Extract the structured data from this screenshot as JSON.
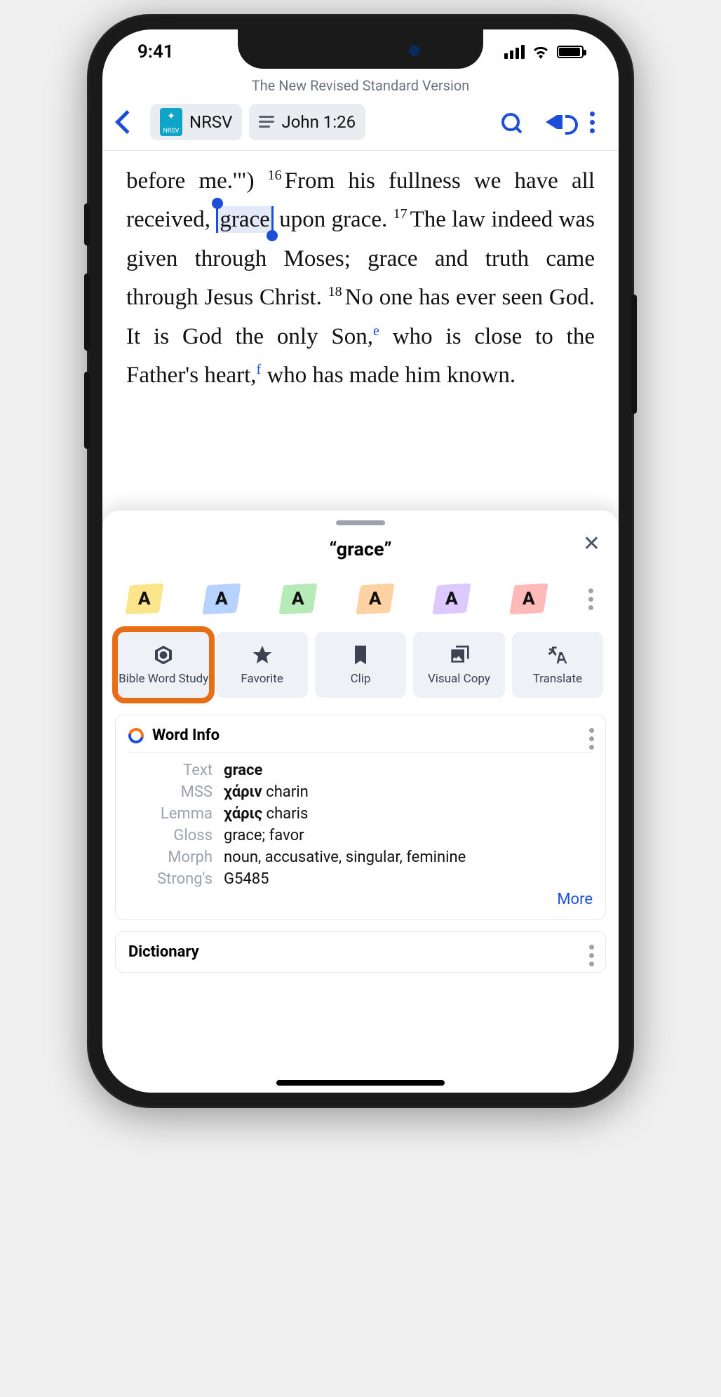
{
  "status": {
    "time": "9:41"
  },
  "header": {
    "version_title": "The New Revised Standard Version",
    "version_abbr": "NRSV",
    "reference": "John 1:26"
  },
  "scripture": {
    "pre_16": "before me.'\")",
    "v16_num": "16",
    "v16_a": "From his fullness we have all received, ",
    "v16_sel": "grace",
    "v16_b": " upon grace.",
    "v17_num": "17",
    "v17": "The law indeed was given through Moses; grace and truth came through Jesus Christ.",
    "v18_num": "18",
    "v18_a": "No one has ever seen God. It is God the only Son,",
    "fn_e": "e",
    "v18_b": " who is close to the Father's heart,",
    "fn_f": "f",
    "v18_c": " who has made him known."
  },
  "sheet": {
    "title": "“grace”",
    "highlight_letter": "A",
    "actions": {
      "word_study": "Bible Word Study",
      "favorite": "Favorite",
      "clip": "Clip",
      "visual_copy": "Visual Copy",
      "translate": "Translate"
    },
    "word_info": {
      "heading": "Word Info",
      "labels": {
        "text": "Text",
        "mss": "MSS",
        "lemma": "Lemma",
        "gloss": "Gloss",
        "morph": "Morph",
        "strongs": "Strong's"
      },
      "text": "grace",
      "mss_greek": "χάριν",
      "mss_translit": "charin",
      "lemma_greek": "χάρις",
      "lemma_translit": "charis",
      "gloss": "grace; favor",
      "morph": "noun, accusative, singular, feminine",
      "strongs": "G5485",
      "more": "More"
    },
    "dictionary_heading": "Dictionary"
  }
}
